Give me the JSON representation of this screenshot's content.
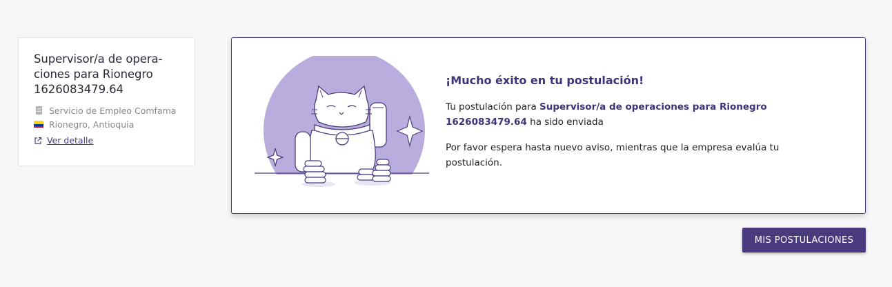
{
  "job": {
    "title": "Supervisor/a de operaciones para Rionegro 1626083479.64",
    "title_line1": "Supervisor/a de opera-",
    "title_line2": "ciones para Rionegro",
    "title_line3": "1626083479.64",
    "employer": "Servicio de Empleo Comfama",
    "location": "Rionegro, Antioquia",
    "detail_link": "Ver detalle",
    "icons": {
      "employer": "building-icon",
      "location": "colombia-flag-icon",
      "link": "external-link-icon"
    }
  },
  "confirmation": {
    "heading": "¡Mucho éxito en tu postulación!",
    "sentence_prefix": "Tu postulación para ",
    "job_name": "Supervisor/a de operaciones para Rionegro 1626083479.64",
    "sentence_suffix": " ha sido enviada",
    "wait_message": "Por favor espera hasta nuevo aviso, mientras que la empresa evalúa tu postulación.",
    "illustration": "lucky-cat-illustration"
  },
  "actions": {
    "my_applications": "MIS POSTULACIONES"
  },
  "colors": {
    "brand": "#4a3b7e",
    "illustration_circle": "#b8addc",
    "background": "#f7f7f7"
  }
}
